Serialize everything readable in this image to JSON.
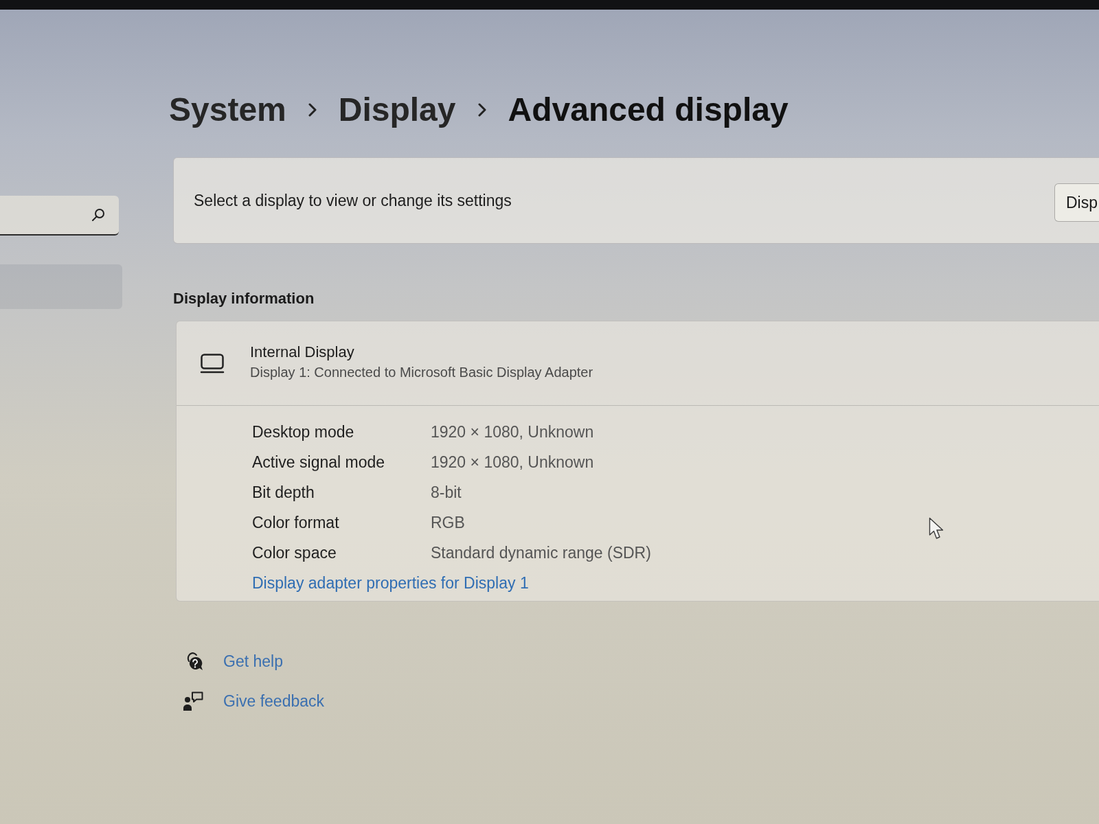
{
  "breadcrumb": [
    "System",
    "Display",
    "Advanced display"
  ],
  "sidebar": {
    "items": [
      {
        "selected": true
      }
    ]
  },
  "display_selector": {
    "prompt": "Select a display to view or change its settings",
    "button": "Disp"
  },
  "display_information": {
    "heading": "Display information",
    "display": {
      "name": "Internal Display",
      "description": "Display 1: Connected to Microsoft Basic Display Adapter"
    },
    "properties": [
      {
        "label": "Desktop mode",
        "value": "1920 × 1080, Unknown"
      },
      {
        "label": "Active signal mode",
        "value": "1920 × 1080, Unknown"
      },
      {
        "label": "Bit depth",
        "value": "8-bit"
      },
      {
        "label": "Color format",
        "value": "RGB"
      },
      {
        "label": "Color space",
        "value": "Standard dynamic range (SDR)"
      }
    ],
    "link": "Display adapter properties for Display 1"
  },
  "related": [
    {
      "kind": "help",
      "label": "Get help"
    },
    {
      "kind": "feedback",
      "label": "Give feedback"
    }
  ]
}
